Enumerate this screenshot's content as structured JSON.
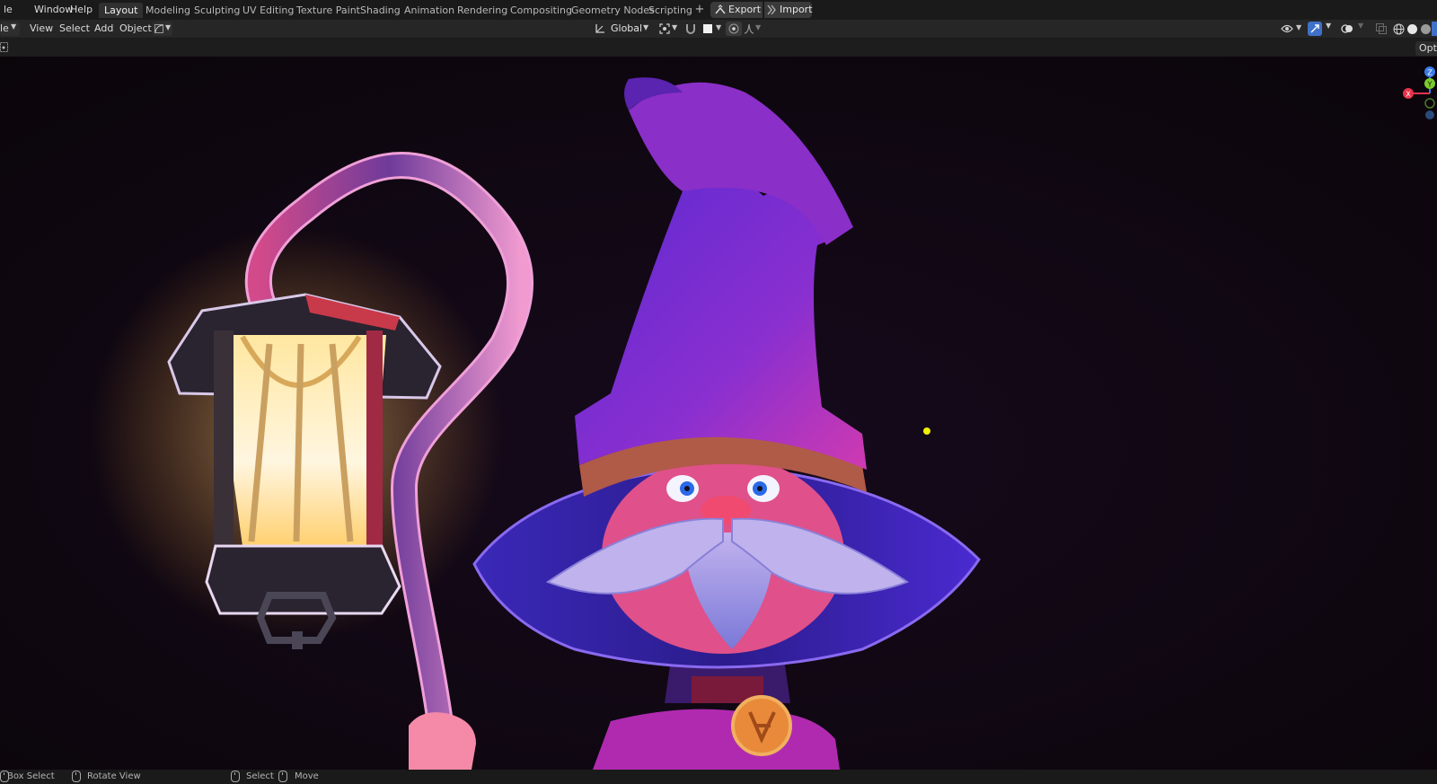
{
  "topbar": {
    "menu": [
      "le",
      "Window",
      "Help"
    ],
    "workspaces": [
      "Layout",
      "Modeling",
      "Sculpting",
      "UV Editing",
      "Texture Paint",
      "Shading",
      "Animation",
      "Rendering",
      "Compositing",
      "Geometry Nodes",
      "Scripting"
    ],
    "active_workspace": "Layout",
    "plus": "+",
    "export_label": "Export",
    "import_label": "Import"
  },
  "header": {
    "mode_fragment": "le",
    "menus": [
      "View",
      "Select",
      "Add",
      "Object"
    ],
    "transform_orientation": "Global"
  },
  "toolstrip": {
    "options_label": "Options"
  },
  "gizmo": {
    "x": "X",
    "y": "Y",
    "z": "Z"
  },
  "statusbar": {
    "box_select": "Box Select",
    "rotate_view": "Rotate View",
    "select": "Select",
    "move": "Move"
  },
  "colors": {
    "topbar_bg": "#1a1a1a",
    "header_bg": "#262626",
    "viewport_bg": "#0d0710",
    "hat_purple": "#6a2fd0",
    "lantern_glow": "#ffd27a",
    "axis_x": "#e8324a",
    "axis_y": "#7acd2a",
    "axis_z": "#3b7ae8",
    "active_tool_blue": "#3f71c8"
  }
}
